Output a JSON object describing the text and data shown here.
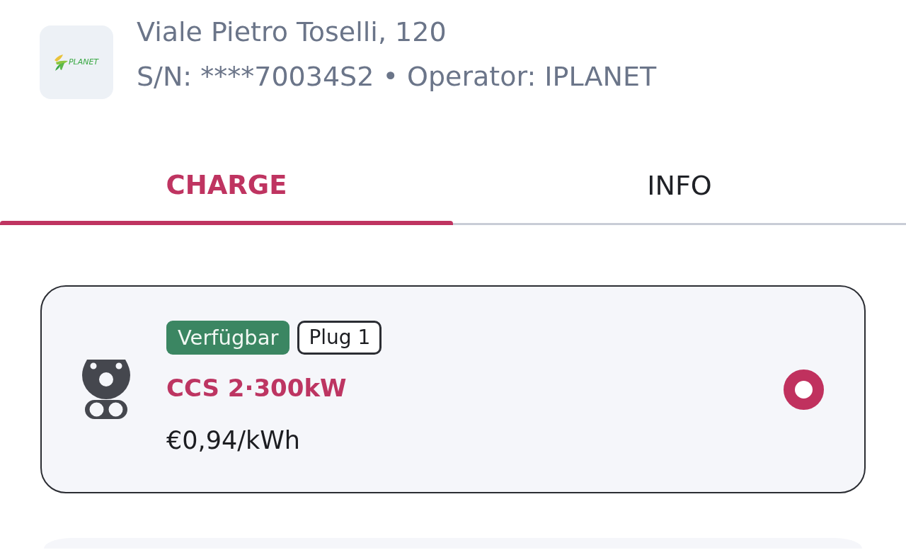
{
  "station": {
    "logo_text": "PLANET",
    "address": "Viale Pietro Toselli, 120",
    "details": "S/N: ****70034S2 • Operator: IPLANET"
  },
  "tabs": [
    {
      "label": "CHARGE",
      "selected": true
    },
    {
      "label": "INFO",
      "selected": false
    }
  ],
  "connectors": [
    {
      "status": "Verfügbar",
      "plug": "Plug 1",
      "name": "CCS 2·300kW",
      "price": "€0,94/kWh",
      "selected": true
    }
  ]
}
